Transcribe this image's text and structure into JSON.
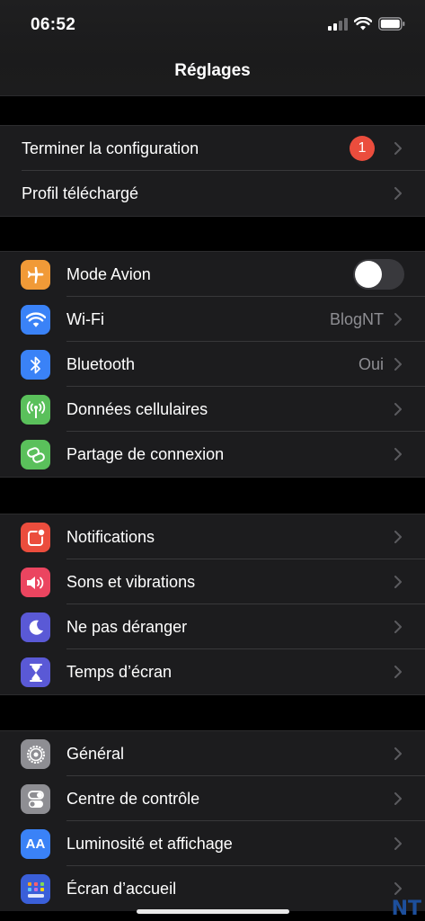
{
  "status": {
    "time": "06:52"
  },
  "header": {
    "title": "Réglages"
  },
  "group1": [
    {
      "label": "Terminer la configuration",
      "badge": "1"
    },
    {
      "label": "Profil téléchargé"
    }
  ],
  "group2": [
    {
      "label": "Mode Avion",
      "icon": "airplane-icon",
      "icon_color": "#f19a37",
      "toggle_on": false
    },
    {
      "label": "Wi-Fi",
      "icon": "wifi-icon",
      "icon_color": "#3a82f7",
      "value": "BlogNT"
    },
    {
      "label": "Bluetooth",
      "icon": "bluetooth-icon",
      "icon_color": "#3a82f7",
      "value": "Oui"
    },
    {
      "label": "Données cellulaires",
      "icon": "antenna-icon",
      "icon_color": "#5ac05b"
    },
    {
      "label": "Partage de connexion",
      "icon": "hotspot-icon",
      "icon_color": "#5ac05b"
    }
  ],
  "group3": [
    {
      "label": "Notifications",
      "icon": "notifications-icon",
      "icon_color": "#eb4d3d"
    },
    {
      "label": "Sons et vibrations",
      "icon": "speaker-icon",
      "icon_color": "#eb4560"
    },
    {
      "label": "Ne pas déranger",
      "icon": "moon-icon",
      "icon_color": "#5a59d6"
    },
    {
      "label": "Temps d’écran",
      "icon": "hourglass-icon",
      "icon_color": "#5a59d6"
    }
  ],
  "group4": [
    {
      "label": "Général",
      "icon": "gear-icon",
      "icon_color": "#8e8e93"
    },
    {
      "label": "Centre de contrôle",
      "icon": "toggles-icon",
      "icon_color": "#8e8e93"
    },
    {
      "label": "Luminosité et affichage",
      "icon": "text-size-icon",
      "icon_color": "#3a82f7",
      "icon_text": "AA"
    },
    {
      "label": "Écran d’accueil",
      "icon": "home-grid-icon",
      "icon_color": "#3a5fd9"
    }
  ],
  "watermark": "NT"
}
